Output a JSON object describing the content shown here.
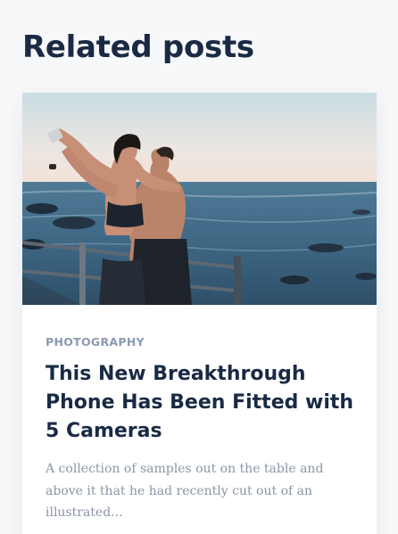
{
  "section": {
    "title": "Related posts"
  },
  "post": {
    "category": "PHOTOGRAPHY",
    "title": "This New Breakthrough Phone Has Been Fitted with 5 Cameras",
    "excerpt": "A collection of samples out on the table and above it that he had recently cut out of an illustrated..."
  },
  "colors": {
    "heading": "#1a2a45",
    "category": "#8b99b0",
    "excerpt": "#8b95a6",
    "page_background": "#f7f8fa",
    "card_background": "#ffffff"
  }
}
